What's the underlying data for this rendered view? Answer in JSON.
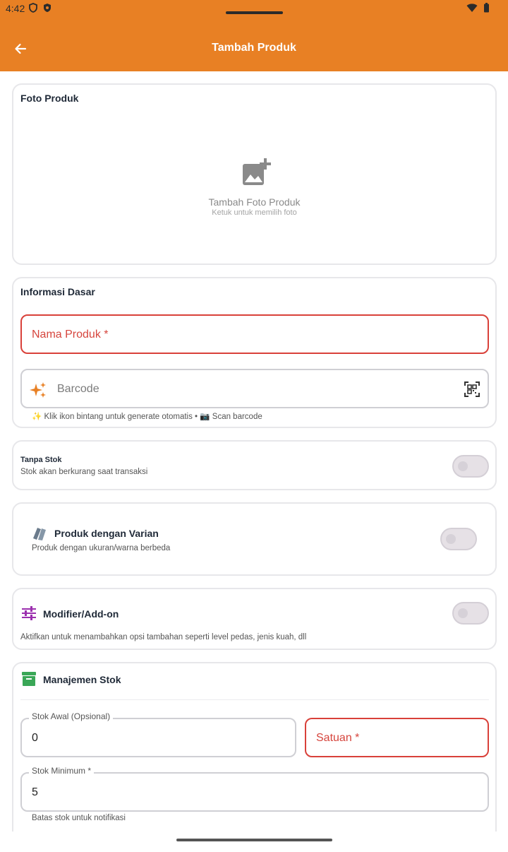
{
  "status_bar": {
    "time": "4:42"
  },
  "appbar": {
    "title": "Tambah Produk"
  },
  "photo_card": {
    "title": "Foto Produk",
    "add_label": "Tambah Foto Produk",
    "hint": "Ketuk untuk memilih foto"
  },
  "basic_info": {
    "title": "Informasi Dasar",
    "name_placeholder": "Nama Produk *",
    "barcode_placeholder": "Barcode",
    "barcode_helper": "✨ Klik ikon bintang untuk generate otomatis • 📷 Scan barcode"
  },
  "no_stock": {
    "title": "Tanpa Stok",
    "subtitle": "Stok akan berkurang saat transaksi"
  },
  "variant": {
    "title": "Produk dengan Varian",
    "subtitle": "Produk dengan ukuran/warna berbeda"
  },
  "modifier": {
    "title": "Modifier/Add-on",
    "subtitle": "Aktifkan untuk menambahkan opsi tambahan seperti level pedas, jenis kuah, dll"
  },
  "stock_mgmt": {
    "title": "Manajemen Stok",
    "initial_label": "Stok Awal (Opsional)",
    "initial_value": "0",
    "unit_placeholder": "Satuan *",
    "min_label": "Stok Minimum *",
    "min_value": "5",
    "min_helper": "Batas stok untuk notifikasi"
  },
  "colors": {
    "primary": "#E88024",
    "error": "#d9413a",
    "green": "#3aa757",
    "purple": "#9b2fae"
  }
}
